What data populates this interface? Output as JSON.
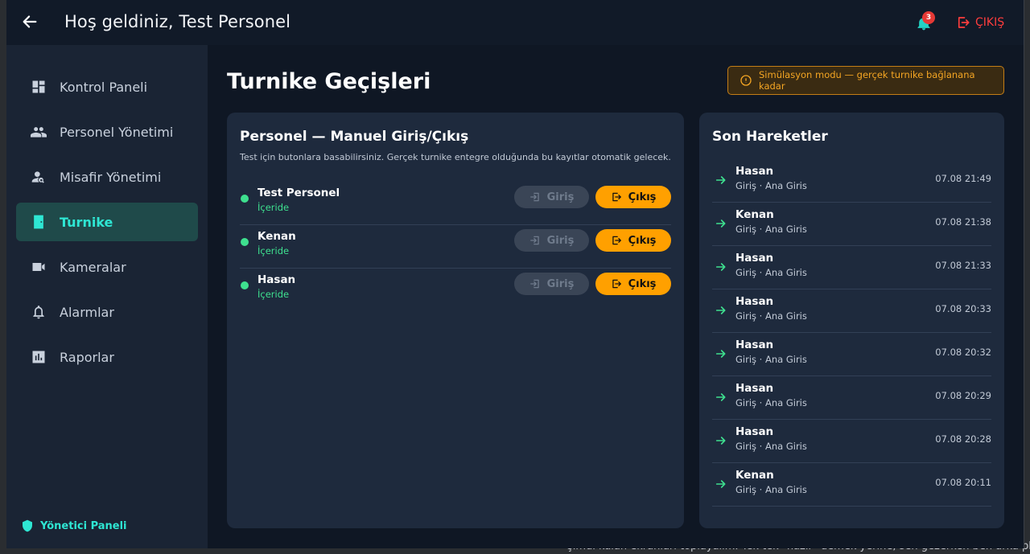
{
  "header": {
    "welcome": "Hoş geldiniz, Test Personel",
    "notification_count": "3",
    "logout_label": "ÇIKIŞ"
  },
  "sidebar": {
    "items": [
      {
        "label": "Kontrol Paneli",
        "icon": "dashboard-icon"
      },
      {
        "label": "Personel Yönetimi",
        "icon": "people-icon"
      },
      {
        "label": "Misafir Yönetimi",
        "icon": "person-search-icon"
      },
      {
        "label": "Turnike",
        "icon": "door-icon",
        "active": true
      },
      {
        "label": "Kameralar",
        "icon": "videocam-icon"
      },
      {
        "label": "Alarmlar",
        "icon": "bell-icon"
      },
      {
        "label": "Raporlar",
        "icon": "bar-chart-icon"
      }
    ],
    "admin_label": "Yönetici Paneli"
  },
  "page": {
    "title": "Turnike Geçişleri",
    "sim_banner": "Simülasyon modu — gerçek turnike bağlanana kadar"
  },
  "manual": {
    "title": "Personel — Manuel Giriş/Çıkış",
    "subtitle": "Test için butonlara basabilirsiniz. Gerçek turnike entegre olduğunda bu kayıtlar otomatik gelecek.",
    "in_label": "Giriş",
    "out_label": "Çıkış",
    "people": [
      {
        "name": "Test Personel",
        "status": "İçeride"
      },
      {
        "name": "Kenan",
        "status": "İçeride"
      },
      {
        "name": "Hasan",
        "status": "İçeride"
      }
    ]
  },
  "recent": {
    "title": "Son Hareketler",
    "items": [
      {
        "name": "Hasan",
        "detail": "Giriş · Ana Giris",
        "time": "07.08 21:49"
      },
      {
        "name": "Kenan",
        "detail": "Giriş · Ana Giris",
        "time": "07.08 21:38"
      },
      {
        "name": "Hasan",
        "detail": "Giriş · Ana Giris",
        "time": "07.08 21:33"
      },
      {
        "name": "Hasan",
        "detail": "Giriş · Ana Giris",
        "time": "07.08 20:33"
      },
      {
        "name": "Hasan",
        "detail": "Giriş · Ana Giris",
        "time": "07.08 20:32"
      },
      {
        "name": "Hasan",
        "detail": "Giriş · Ana Giris",
        "time": "07.08 20:29"
      },
      {
        "name": "Hasan",
        "detail": "Giriş · Ana Giris",
        "time": "07.08 20:28"
      },
      {
        "name": "Kenan",
        "detail": "Giriş · Ana Giris",
        "time": "07.08 20:11"
      }
    ]
  },
  "background": {
    "bottom_text": "şimdi kalan ekranları toplayalım. Tek tek \"hazır\" demek yerine, sen gezerken ben arka pla"
  },
  "colors": {
    "accent": "#2ee6d3",
    "warning": "#ffa000",
    "success": "#3ee08f",
    "danger": "#ff3d3d"
  }
}
